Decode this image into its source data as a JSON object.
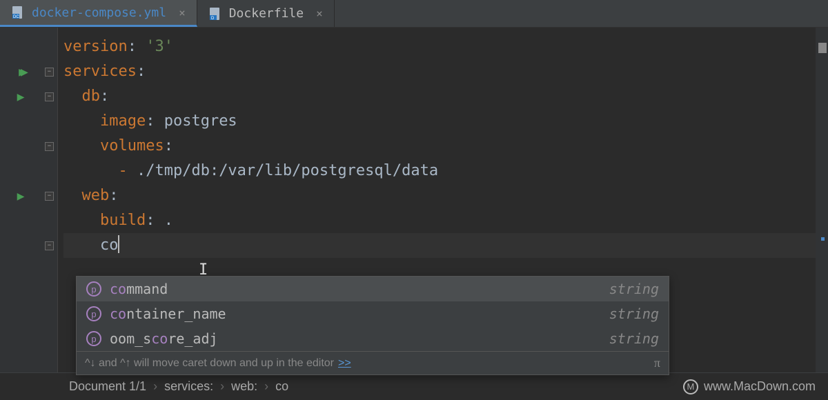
{
  "tabs": [
    {
      "label": "docker-compose.yml",
      "icon_badge": "DC",
      "active": true
    },
    {
      "label": "Dockerfile",
      "icon_badge": "D",
      "active": false
    }
  ],
  "code": {
    "lines": [
      {
        "indent": 0,
        "key": "version",
        "sep": ": ",
        "val": "'3'",
        "val_class": "k-str"
      },
      {
        "indent": 0,
        "key": "services",
        "sep": ":",
        "val": ""
      },
      {
        "indent": 1,
        "key": "db",
        "sep": ":",
        "val": ""
      },
      {
        "indent": 2,
        "key": "image",
        "sep": ": ",
        "val": "postgres",
        "val_class": "k-val"
      },
      {
        "indent": 2,
        "key": "volumes",
        "sep": ":",
        "val": ""
      },
      {
        "indent": 3,
        "dash": "- ",
        "val": "./tmp/db:/var/lib/postgresql/data",
        "val_class": "k-val"
      },
      {
        "indent": 1,
        "key": "web",
        "sep": ":",
        "val": ""
      },
      {
        "indent": 2,
        "key": "build",
        "sep": ": ",
        "val": ".",
        "val_class": "k-val"
      },
      {
        "indent": 2,
        "typed": "co",
        "current": true
      }
    ]
  },
  "gutter": [
    {
      "run": ""
    },
    {
      "run": "double"
    },
    {
      "run": "single"
    },
    {
      "run": ""
    },
    {
      "run": ""
    },
    {
      "run": ""
    },
    {
      "run": "single"
    },
    {
      "run": ""
    },
    {
      "run": ""
    }
  ],
  "fold": [
    false,
    true,
    true,
    false,
    true,
    false,
    true,
    false,
    true
  ],
  "autocomplete": {
    "items": [
      {
        "name": "command",
        "match_prefix": "co",
        "rest": "mmand",
        "type": "string",
        "selected": true
      },
      {
        "name": "container_name",
        "match_prefix": "co",
        "rest": "ntainer_name",
        "type": "string",
        "selected": false
      },
      {
        "name": "oom_score_adj",
        "pre": "oom_s",
        "match": "co",
        "post": "re_adj",
        "type": "string",
        "selected": false
      }
    ],
    "hint": "^↓ and ^↑ will move caret down and up in the editor",
    "hint_link": ">>",
    "pi": "π"
  },
  "breadcrumb": [
    "Document 1/1",
    "services:",
    "web:",
    "co"
  ],
  "footer_brand": "www.MacDown.com"
}
